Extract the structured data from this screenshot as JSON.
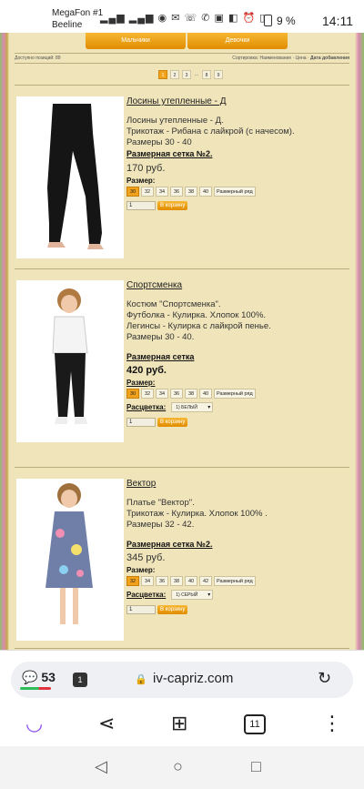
{
  "status": {
    "carrier1": "MegaFon #1",
    "carrier2": "Beeline",
    "battery": "9 %",
    "time": "14:11"
  },
  "page": {
    "tabs": [
      "Мальчики",
      "Девочки"
    ],
    "found_label": "Доступно позиций: 89",
    "sort_label": "Сортировка: Наименование · Цена · ",
    "sort_active": "Дата добавления",
    "pages": [
      "1",
      "2",
      "3",
      "...",
      "8",
      "9"
    ]
  },
  "products": [
    {
      "title": "Лосины утепленные - Д",
      "desc": [
        "Лосины утепленные - Д.",
        "Трикотаж - Рибана с лайкрой (с начесом).",
        "Размеры 30 - 40"
      ],
      "size_grid": "Размерная сетка №2.",
      "price": "170 руб.",
      "size_label": "Размер:",
      "sizes": [
        "30",
        "32",
        "34",
        "36",
        "38",
        "40",
        "Размерный ряд"
      ],
      "color_label": "",
      "color_value": "",
      "qty": "1",
      "cart": "В корзину"
    },
    {
      "title": "Спортсменка",
      "desc": [
        "Костюм \"Спортсменка\".",
        "Футболка - Кулирка. Хлопок 100%.",
        "Легинсы - Кулирка с лайкрой пенье.",
        "Размеры 30 - 40."
      ],
      "size_grid": "Размерная сетка",
      "price": "420 руб.",
      "size_label": "Размер:",
      "sizes": [
        "30",
        "32",
        "34",
        "36",
        "38",
        "40",
        "Размерный ряд"
      ],
      "color_label": "Расцветка:",
      "color_value": "1) БЕЛЫЙ",
      "qty": "1",
      "cart": "В корзину"
    },
    {
      "title": "Вектор",
      "desc": [
        "Платье \"Вектор\".",
        "Трикотаж - Кулирка. Хлопок 100% .",
        "Размеры 32 - 42."
      ],
      "size_grid": "Размерная сетка №2.",
      "price": "345 руб.",
      "size_label": "Размер:",
      "sizes": [
        "32",
        "34",
        "36",
        "38",
        "40",
        "42",
        "Размерный ряд"
      ],
      "color_label": "Расцветка:",
      "color_value": "1) СЕРЫЙ",
      "qty": "1",
      "cart": "В корзину"
    }
  ],
  "browser": {
    "messages": "53",
    "tabs_badge": "1",
    "domain": "iv-capriz.com",
    "tab_count": "11"
  }
}
